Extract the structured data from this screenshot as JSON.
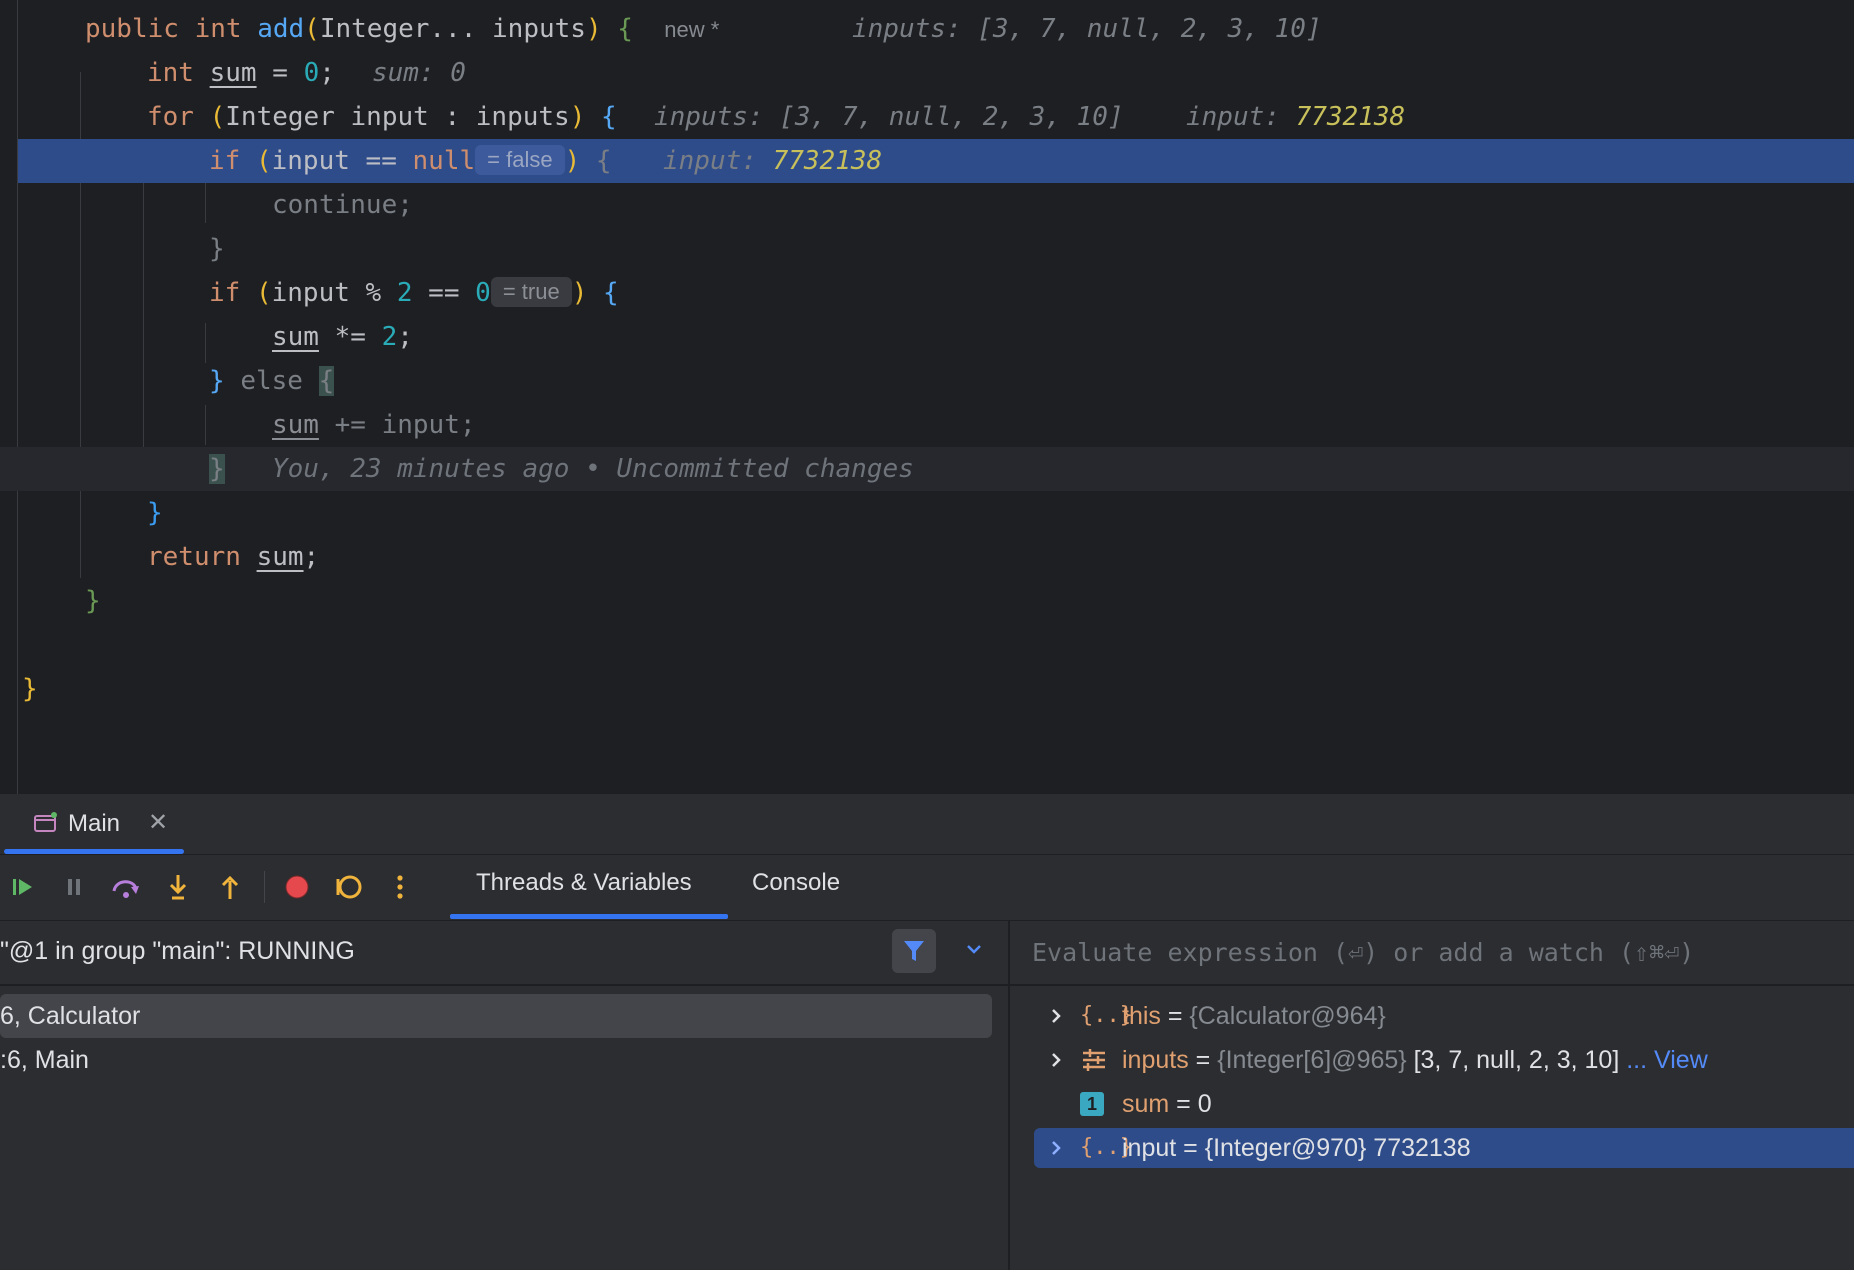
{
  "editor": {
    "lines": {
      "l1": {
        "kw1": "public",
        "kw2": "int",
        "fn": "add",
        "open": "(",
        "type": "Integer...",
        "param": "inputs",
        "close": ")",
        "brace": "{",
        "new_tag": "new *",
        "hint": "inputs: [3, 7, null, 2, 3, 10]"
      },
      "l2": {
        "kw": "int",
        "var": "sum",
        "eq": " = ",
        "num": "0",
        "semi": ";",
        "hint": "sum: 0"
      },
      "l3": {
        "kw": "for",
        "open": "(",
        "type": "Integer",
        "name": "input",
        "colon": " : ",
        "coll": "inputs",
        "close": ")",
        "brace": "{",
        "hint1": "inputs: [3, 7, null, 2, 3, 10]",
        "hint2_label": "input: ",
        "hint2_value": "7732138"
      },
      "l4": {
        "kw": "if",
        "open": "(",
        "var": "input",
        "op": " == ",
        "kw2": "null",
        "inlay": "= false",
        "close": ")",
        "brace": "{",
        "hint_label": "input: ",
        "hint_value": "7732138"
      },
      "l5": {
        "stmt": "continue;"
      },
      "l6": {
        "brace": "}"
      },
      "l7": {
        "kw": "if",
        "open": "(",
        "var": "input",
        "mod": " % ",
        "n1": "2",
        "op": " == ",
        "n2": "0",
        "inlay": "= true",
        "close": ")",
        "brace": "{"
      },
      "l8": {
        "var": "sum",
        "op": " *= ",
        "num": "2",
        "semi": ";"
      },
      "l9": {
        "brace": "}",
        "kw": "else",
        "brace2": "{"
      },
      "l10": {
        "var": "sum",
        "rest": " += input;"
      },
      "l11": {
        "brace": "}",
        "blame": "You, 23 minutes ago • Uncommitted changes"
      },
      "l12": {
        "brace": "}"
      },
      "l13": {
        "kw": "return",
        "var": "sum",
        "semi": ";"
      },
      "l14": {
        "brace": "}"
      },
      "l16": {
        "brace": "}"
      }
    }
  },
  "debug": {
    "tab_label": "Main",
    "view_tabs": [
      "Threads & Variables",
      "Console"
    ],
    "thread_status": "\"@1 in group \"main\": RUNNING",
    "frames": [
      "6, Calculator",
      ":6, Main"
    ],
    "eval_placeholder": "Evaluate expression (⏎) or add a watch (⇧⌘⏎)",
    "variables": [
      {
        "name": "this",
        "eq": " = ",
        "type": "{Calculator@964}",
        "value": "",
        "icon": "object-icon"
      },
      {
        "name": "inputs",
        "eq": " = ",
        "type": "{Integer[6]@965}",
        "value": " [3, 7, null, 2, 3, 10]",
        "link": " ... View",
        "icon": "array-icon"
      },
      {
        "name": "sum",
        "eq": " = ",
        "type": "",
        "value": "0",
        "icon": "primitive-icon"
      },
      {
        "name": "input",
        "eq": " = ",
        "type": "",
        "value": "{Integer@970} 7732138",
        "icon": "object-icon"
      }
    ]
  },
  "colors": {
    "accent": "#3574f0",
    "execution_line": "#2f4c8a",
    "resume": "#5fb865",
    "stop": "#e5484d"
  }
}
